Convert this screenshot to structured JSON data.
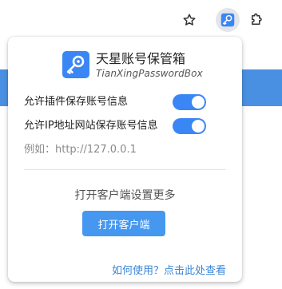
{
  "toolbar": {
    "star_icon": "star-icon",
    "extension_icon": "key-icon",
    "puzzle_icon": "puzzle-icon"
  },
  "popup": {
    "title": "天星账号保管箱",
    "subtitle": "TianXingPasswordBox",
    "settings": [
      {
        "label": "允许插件保存账号信息",
        "enabled": true
      },
      {
        "label": "允许IP地址网站保存账号信息",
        "enabled": true
      }
    ],
    "example": "例如：http://127.0.0.1",
    "more_text": "打开客户端设置更多",
    "open_button": "打开客户端",
    "help_link": "如何使用？点击此处查看"
  },
  "colors": {
    "accent": "#3b86f5",
    "button": "#4597f0",
    "link": "#3a86d8",
    "page_strip": "#4a90e2"
  }
}
